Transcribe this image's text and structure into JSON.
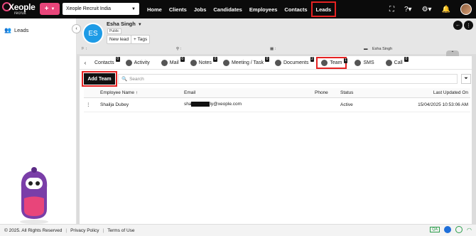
{
  "brand": {
    "name": "Xeople",
    "sub": "recruit"
  },
  "tenant": {
    "name": "Xeople Recruit India"
  },
  "nav": [
    "Home",
    "Clients",
    "Jobs",
    "Candidates",
    "Employees",
    "Contacts",
    "Leads"
  ],
  "sidebar": {
    "leads_label": "Leads"
  },
  "lead": {
    "initials": "ES",
    "name": "Esha Singh",
    "badge": "Public",
    "status_btn": "New lead",
    "tags_btn": "Tags",
    "owner": "Esha Singh"
  },
  "tabs": [
    {
      "label": "Contacts",
      "count": "0"
    },
    {
      "label": "Activity",
      "count": ""
    },
    {
      "label": "Mail",
      "count": "0"
    },
    {
      "label": "Notes",
      "count": "0"
    },
    {
      "label": "Meeting / Task",
      "count": "0"
    },
    {
      "label": "Documents",
      "count": "2"
    },
    {
      "label": "Team",
      "count": "1"
    },
    {
      "label": "SMS",
      "count": ""
    },
    {
      "label": "Call",
      "count": "0"
    }
  ],
  "toolbar": {
    "add_team": "Add Team",
    "search_placeholder": "Search"
  },
  "table": {
    "headers": [
      "Employee Name",
      "Email",
      "Phone",
      "Status",
      "Last Updated On"
    ],
    "rows": [
      {
        "name": "Shailja Dubey",
        "email_start": "sha",
        "email_end": "ly@xeople.com",
        "phone": "",
        "status": "Active",
        "updated": "15/04/2025 10:53:06 AM"
      }
    ]
  },
  "footer": {
    "copyright": "© 2025. All Rights Reserved",
    "privacy": "Privacy Policy",
    "terms": "Terms of Use",
    "qa": "QA"
  }
}
